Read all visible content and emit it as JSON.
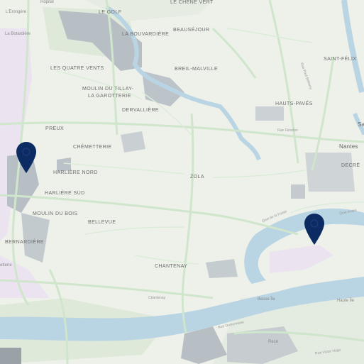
{
  "colors": {
    "background": "#eef0ea",
    "water": "#b9d4e3",
    "built": "#b7bfc5",
    "green": "#dfe9da",
    "road": "#cfe5cc",
    "industrial": "#ece3f0",
    "marker": "#0d2b63"
  },
  "labels": {
    "hopital": "Hôpital",
    "lerongere": "L'Erongère",
    "le_chene_vert": "LE CHÊNE VERT",
    "le_golf": "LE GOLF",
    "la_bouvardiere": "LA BOUVARDIÈRE",
    "beausejour": "BEAUSÉJOUR",
    "la_botardiere": "La Botardière",
    "les_quatre_vents": "LES QUATRE VENTS",
    "breil_malville": "BREIL-MALVILLE",
    "saint_felix": "SAINT-FÉLIX",
    "moulin_du_tillay_1": "MOULIN DU TILLAY-",
    "moulin_du_tillay_2": "LA GAROTTERIE",
    "hauts_paves": "HAUTS-PAVÉS",
    "dervalliere": "DERVALLIÈRE",
    "preux": "PREUX",
    "rue_fenelon": "Rue Fénelon",
    "cremetterie": "CRÉMETTERIE",
    "nantes": "Nantes",
    "decre": "DECRÉ",
    "harliere_nord": "HARLIÈRE NORD",
    "zola": "ZOLA",
    "harliere_sud": "HARLIÈRE SUD",
    "moulin_du_bois": "MOULIN DU BOIS",
    "bellevue": "BELLEVUE",
    "bernardiere": "BERNARDIÈRE",
    "chantenay": "CHANTENAY",
    "etterie": "etterie",
    "chantenay_small": "Chantenay",
    "basse_ile": "Basse Île",
    "haute_ile": "Haute Île",
    "reze": "Rezé",
    "rue_de_la_fosse": "Quai de la Fosse",
    "quai_andre": "Quai André",
    "rue_de_saint": "Rue Paul Bellamy",
    "rue_victor_hugo": "Rue Victor Hugo",
    "rue_ordronneau": "Rue Ordronneau",
    "sa": "Sa"
  },
  "markers": [
    {
      "name": "map-marker-west",
      "icon": "map-pin-icon"
    },
    {
      "name": "map-marker-east",
      "icon": "map-pin-icon"
    }
  ]
}
